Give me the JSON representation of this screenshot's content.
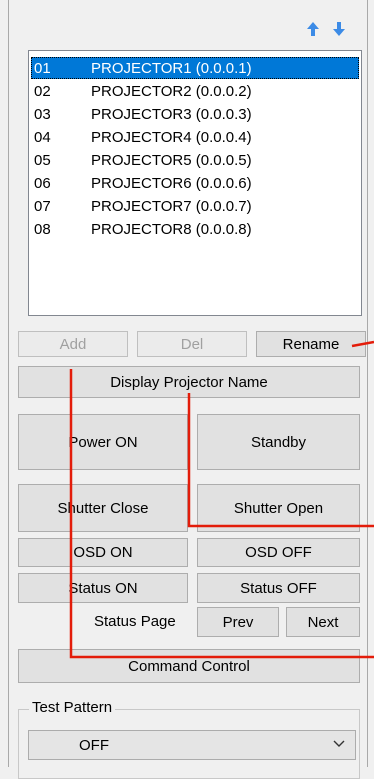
{
  "list": {
    "items": [
      {
        "num": "01",
        "name": "PROJECTOR1 (0.0.0.1)"
      },
      {
        "num": "02",
        "name": "PROJECTOR2 (0.0.0.2)"
      },
      {
        "num": "03",
        "name": "PROJECTOR3 (0.0.0.3)"
      },
      {
        "num": "04",
        "name": "PROJECTOR4 (0.0.0.4)"
      },
      {
        "num": "05",
        "name": "PROJECTOR5 (0.0.0.5)"
      },
      {
        "num": "06",
        "name": "PROJECTOR6 (0.0.0.6)"
      },
      {
        "num": "07",
        "name": "PROJECTOR7 (0.0.0.7)"
      },
      {
        "num": "08",
        "name": "PROJECTOR8 (0.0.0.8)"
      }
    ],
    "selected_index": 0
  },
  "buttons": {
    "add": "Add",
    "del": "Del",
    "rename": "Rename",
    "display_name": "Display Projector Name",
    "power_on": "Power ON",
    "standby": "Standby",
    "shutter_close": "Shutter Close",
    "shutter_open": "Shutter Open",
    "osd_on": "OSD ON",
    "osd_off": "OSD OFF",
    "status_on": "Status ON",
    "status_off": "Status OFF",
    "prev": "Prev",
    "next": "Next",
    "command_control": "Command Control"
  },
  "status_page_label": "Status Page",
  "test_pattern": {
    "label": "Test Pattern",
    "value": "OFF"
  },
  "colors": {
    "selection": "#0078d7",
    "callout": "#e31c0a",
    "arrow": "#3c8be6"
  }
}
